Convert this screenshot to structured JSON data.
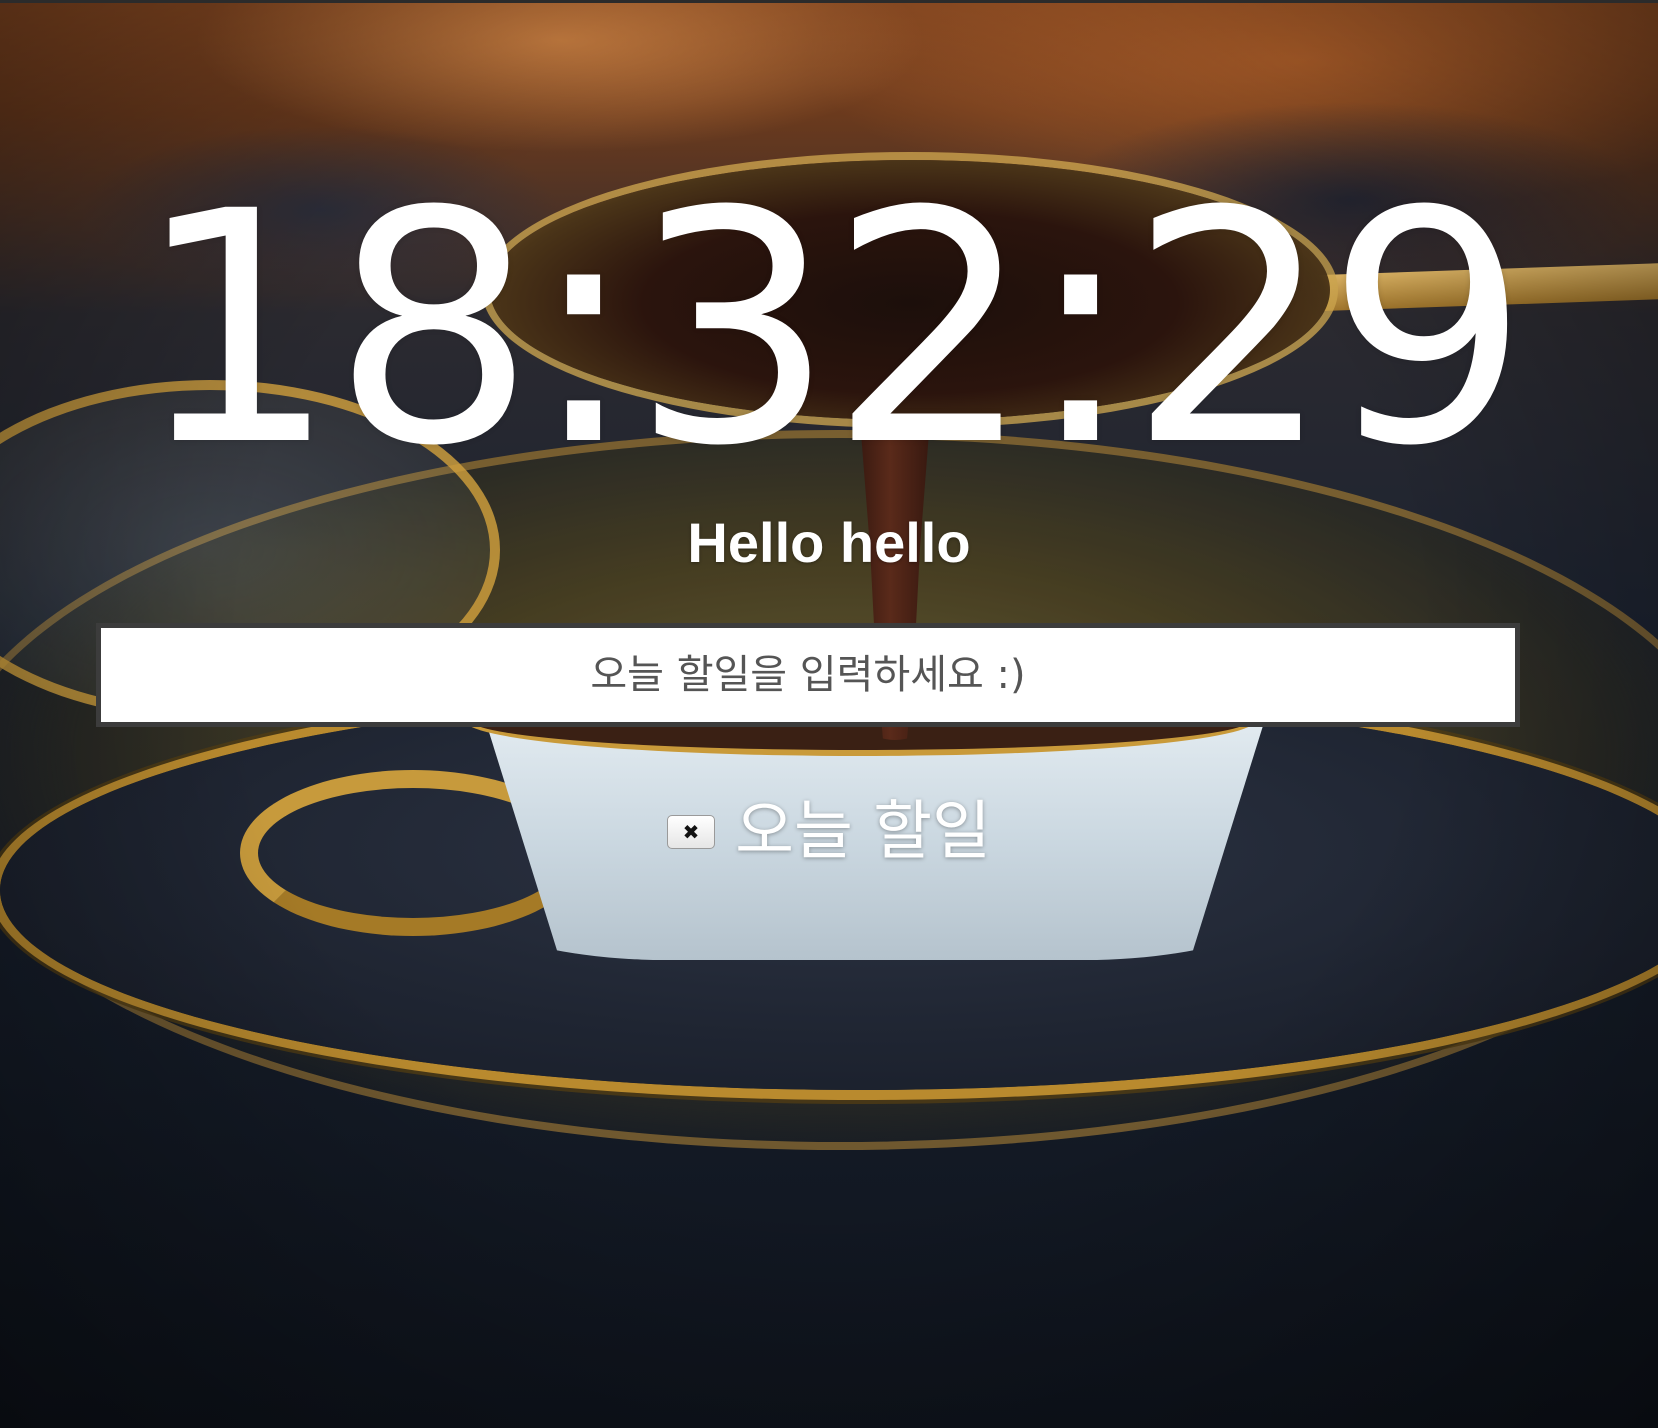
{
  "clock": {
    "time": "18:32:29"
  },
  "greeting": {
    "text": "Hello hello"
  },
  "todo_form": {
    "placeholder": "오늘 할일을 입력하세요 :)",
    "value": ""
  },
  "todo_list": {
    "items": [
      {
        "delete_label": "✖",
        "text": "오늘 할일"
      }
    ]
  },
  "colors": {
    "text": "#ffffff",
    "input_border": "#3c3c3c",
    "input_background": "#ffffff"
  },
  "icons": {
    "delete": "close-icon"
  }
}
